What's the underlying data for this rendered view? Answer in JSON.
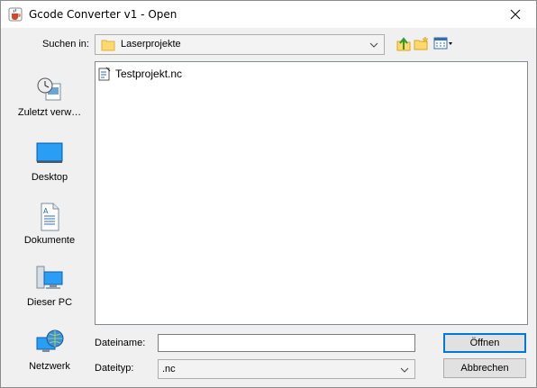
{
  "window": {
    "title": "Gcode Converter v1 - Open"
  },
  "icons": {
    "app": "java-cup-icon",
    "close": "close-icon",
    "folder": "folder-icon",
    "up": "up-folder-icon",
    "new_folder": "new-folder-icon",
    "view": "view-menu-icon",
    "file": "nc-file-icon"
  },
  "lookin": {
    "label": "Suchen in:",
    "value": "Laserprojekte"
  },
  "sidebar": {
    "items": [
      {
        "label": "Zuletzt verw…",
        "icon": "recent-icon"
      },
      {
        "label": "Desktop",
        "icon": "desktop-icon"
      },
      {
        "label": "Dokumente",
        "icon": "documents-icon"
      },
      {
        "label": "Dieser PC",
        "icon": "computer-icon"
      },
      {
        "label": "Netzwerk",
        "icon": "network-icon"
      }
    ]
  },
  "files": [
    {
      "name": "Testprojekt.nc"
    }
  ],
  "filename": {
    "label": "Dateiname:",
    "value": ""
  },
  "filetype": {
    "label": "Dateityp:",
    "value": ".nc"
  },
  "buttons": {
    "open": "Öffnen",
    "cancel": "Abbrechen"
  },
  "colors": {
    "accent": "#0078d7",
    "background": "#f0f0f0"
  }
}
